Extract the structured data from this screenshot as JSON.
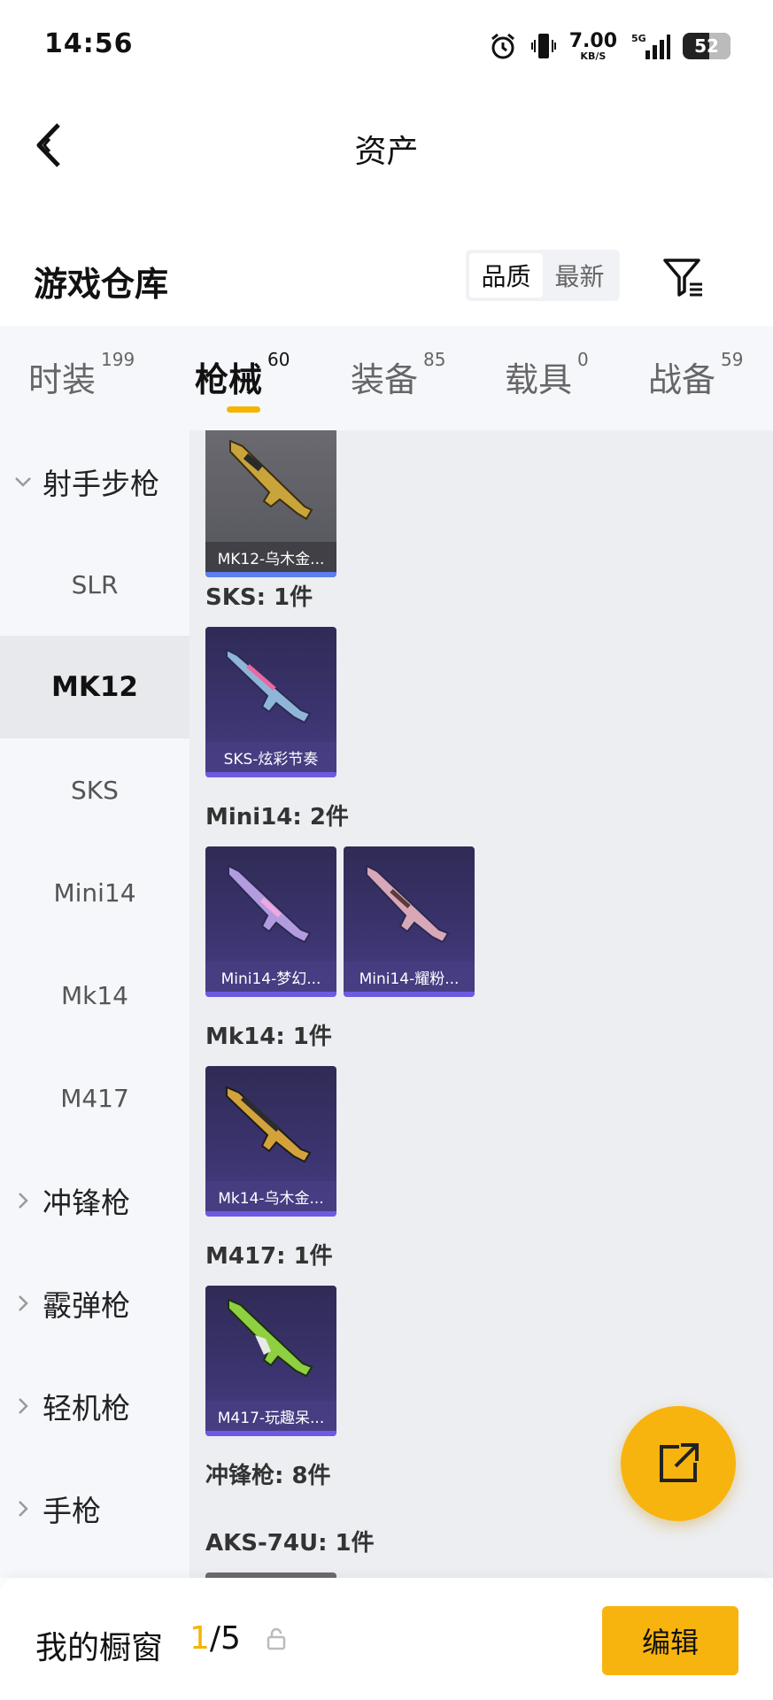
{
  "status_bar": {
    "time": "14:56",
    "net_speed_value": "7.00",
    "net_speed_unit": "KB/S",
    "network": "5G",
    "battery": "52"
  },
  "header": {
    "title": "资产"
  },
  "warehouse": {
    "title": "游戏仓库",
    "sort_options": [
      "品质",
      "最新"
    ],
    "sort_active": "品质"
  },
  "tabs": [
    {
      "label": "时装",
      "count": "199"
    },
    {
      "label": "枪械",
      "count": "60"
    },
    {
      "label": "装备",
      "count": "85"
    },
    {
      "label": "载具",
      "count": "0"
    },
    {
      "label": "战备",
      "count": "59"
    }
  ],
  "active_tab": "枪械",
  "sidebar": {
    "group_expanded": "射手步枪",
    "sub_items": [
      "SLR",
      "MK12",
      "SKS",
      "Mini14",
      "Mk14",
      "M417"
    ],
    "active_item": "MK12",
    "collapsed_groups": [
      "冲锋枪",
      "霰弹枪",
      "轻机枪",
      "手枪"
    ]
  },
  "content": {
    "mk12_card": "MK12-乌木金...",
    "sks_label": "SKS: 1件",
    "sks_card": "SKS-炫彩节奏",
    "mini14_label": "Mini14: 2件",
    "mini14_cards": [
      "Mini14-梦幻...",
      "Mini14-耀粉..."
    ],
    "mk14_label": "Mk14: 1件",
    "mk14_card": "Mk14-乌木金...",
    "m417_label": "M417: 1件",
    "m417_card": "M417-玩趣呆...",
    "smg_label": "冲锋枪: 8件",
    "aks_label": "AKS-74U: 1件"
  },
  "bottom": {
    "title": "我的橱窗",
    "current": "1",
    "total": "/5",
    "edit_label": "编辑"
  },
  "colors": {
    "accent": "#f8b40e",
    "sidebar_bg": "#f5f7fa",
    "content_bg": "#eceef1",
    "card_purple": "#3c3470"
  }
}
